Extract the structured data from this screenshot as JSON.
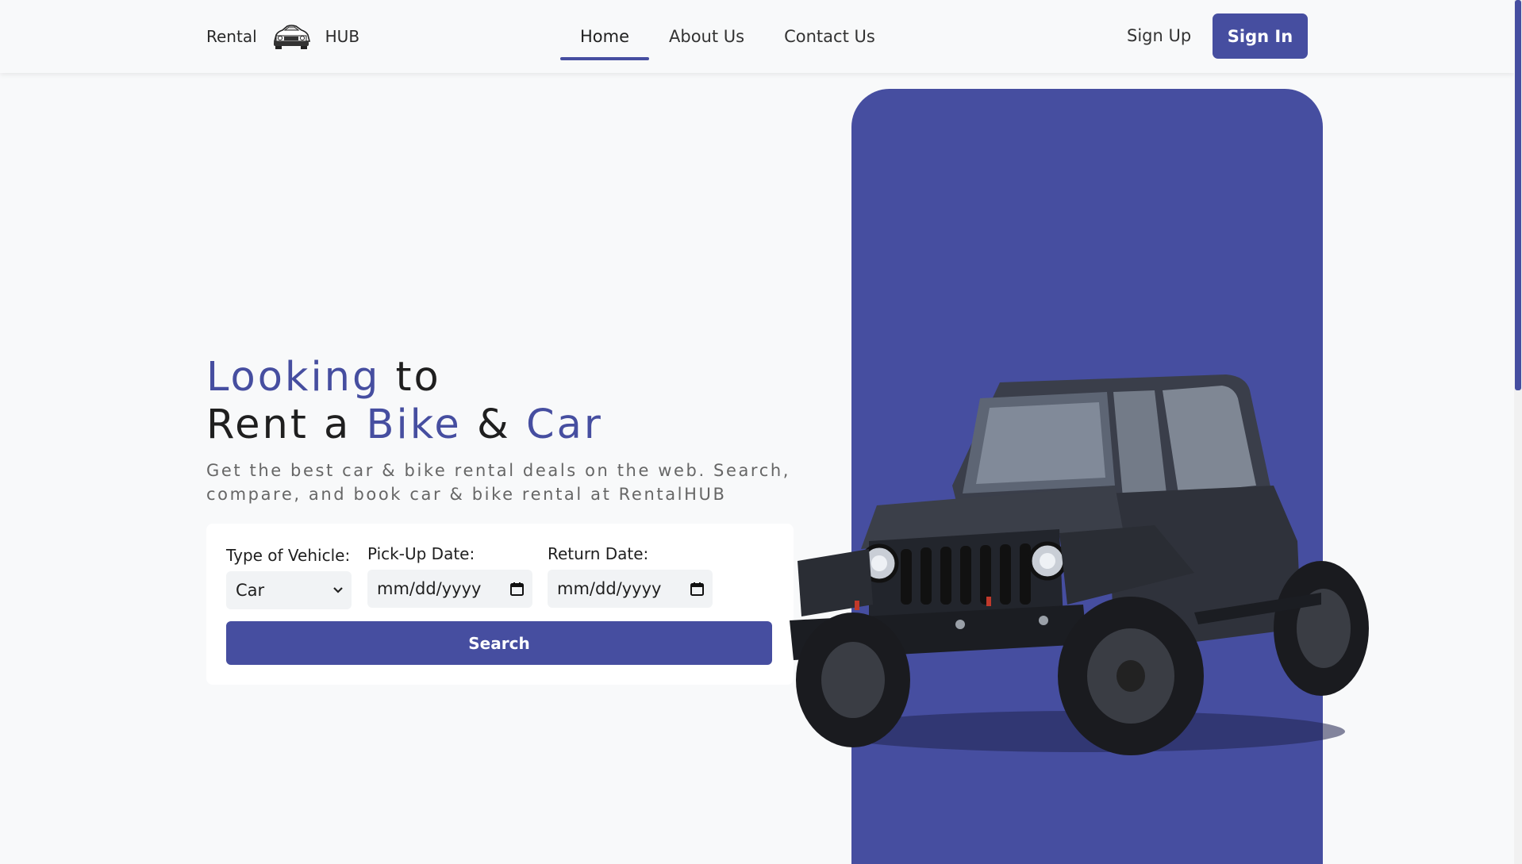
{
  "brand": {
    "left": "Rental",
    "right": "HUB",
    "logo_icon": "car-logo-icon"
  },
  "nav": {
    "items": [
      {
        "label": "Home",
        "active": true
      },
      {
        "label": "About Us",
        "active": false
      },
      {
        "label": "Contact Us",
        "active": false
      }
    ],
    "sign_up": "Sign Up",
    "sign_in": "Sign In"
  },
  "hero": {
    "headline_1a": "Looking",
    "headline_1b": " to",
    "headline_2a": "Rent a ",
    "headline_2b": "Bike",
    "headline_2c": " & ",
    "headline_2d": "Car",
    "subtitle": "Get the best car & bike rental deals on the web. Search, compare, and book car & bike rental at RentalHUB",
    "image_icon": "jeep-image"
  },
  "search": {
    "vehicle_label": "Type of Vehicle:",
    "vehicle_value": "Car",
    "pickup_label": "Pick-Up Date:",
    "pickup_placeholder": "mm/dd/yyyy",
    "return_label": "Return Date:",
    "return_placeholder": "mm/dd/yyyy",
    "button": "Search"
  },
  "colors": {
    "accent": "#464ea0",
    "background": "#f8f9fa",
    "card": "#ffffff"
  }
}
